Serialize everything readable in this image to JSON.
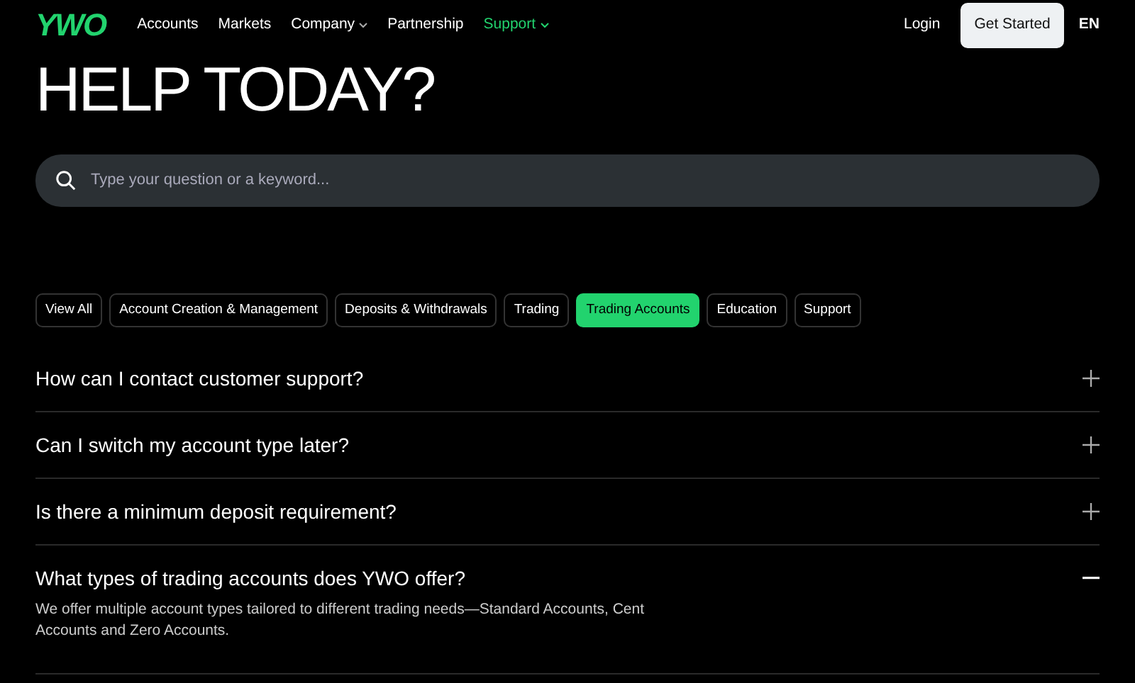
{
  "logo": "YWO",
  "nav": [
    {
      "label": "Accounts",
      "dropdown": false,
      "selected": false
    },
    {
      "label": "Markets",
      "dropdown": false,
      "selected": false
    },
    {
      "label": "Company",
      "dropdown": true,
      "selected": false
    },
    {
      "label": "Partnership",
      "dropdown": false,
      "selected": false
    },
    {
      "label": "Support",
      "dropdown": true,
      "selected": true
    }
  ],
  "login": "Login",
  "get_started": "Get Started",
  "language": "EN",
  "heading": "HELP TODAY?",
  "search": {
    "placeholder": "Type your question or a keyword..."
  },
  "filters": [
    {
      "label": "View All",
      "selected": false
    },
    {
      "label": "Account Creation & Management",
      "selected": false
    },
    {
      "label": "Deposits & Withdrawals",
      "selected": false
    },
    {
      "label": "Trading",
      "selected": false
    },
    {
      "label": "Trading Accounts",
      "selected": true
    },
    {
      "label": "Education",
      "selected": false
    },
    {
      "label": "Support",
      "selected": false
    }
  ],
  "faqs": [
    {
      "question": "How can I contact customer support?",
      "expanded": false
    },
    {
      "question": "Can I switch my account type later?",
      "expanded": false
    },
    {
      "question": "Is there a minimum deposit requirement?",
      "expanded": false
    },
    {
      "question": "What types of trading accounts does YWO offer?",
      "expanded": true,
      "answer": "We offer multiple account types tailored to different trading needs—Standard Accounts, Cent Accounts and Zero Accounts."
    }
  ]
}
